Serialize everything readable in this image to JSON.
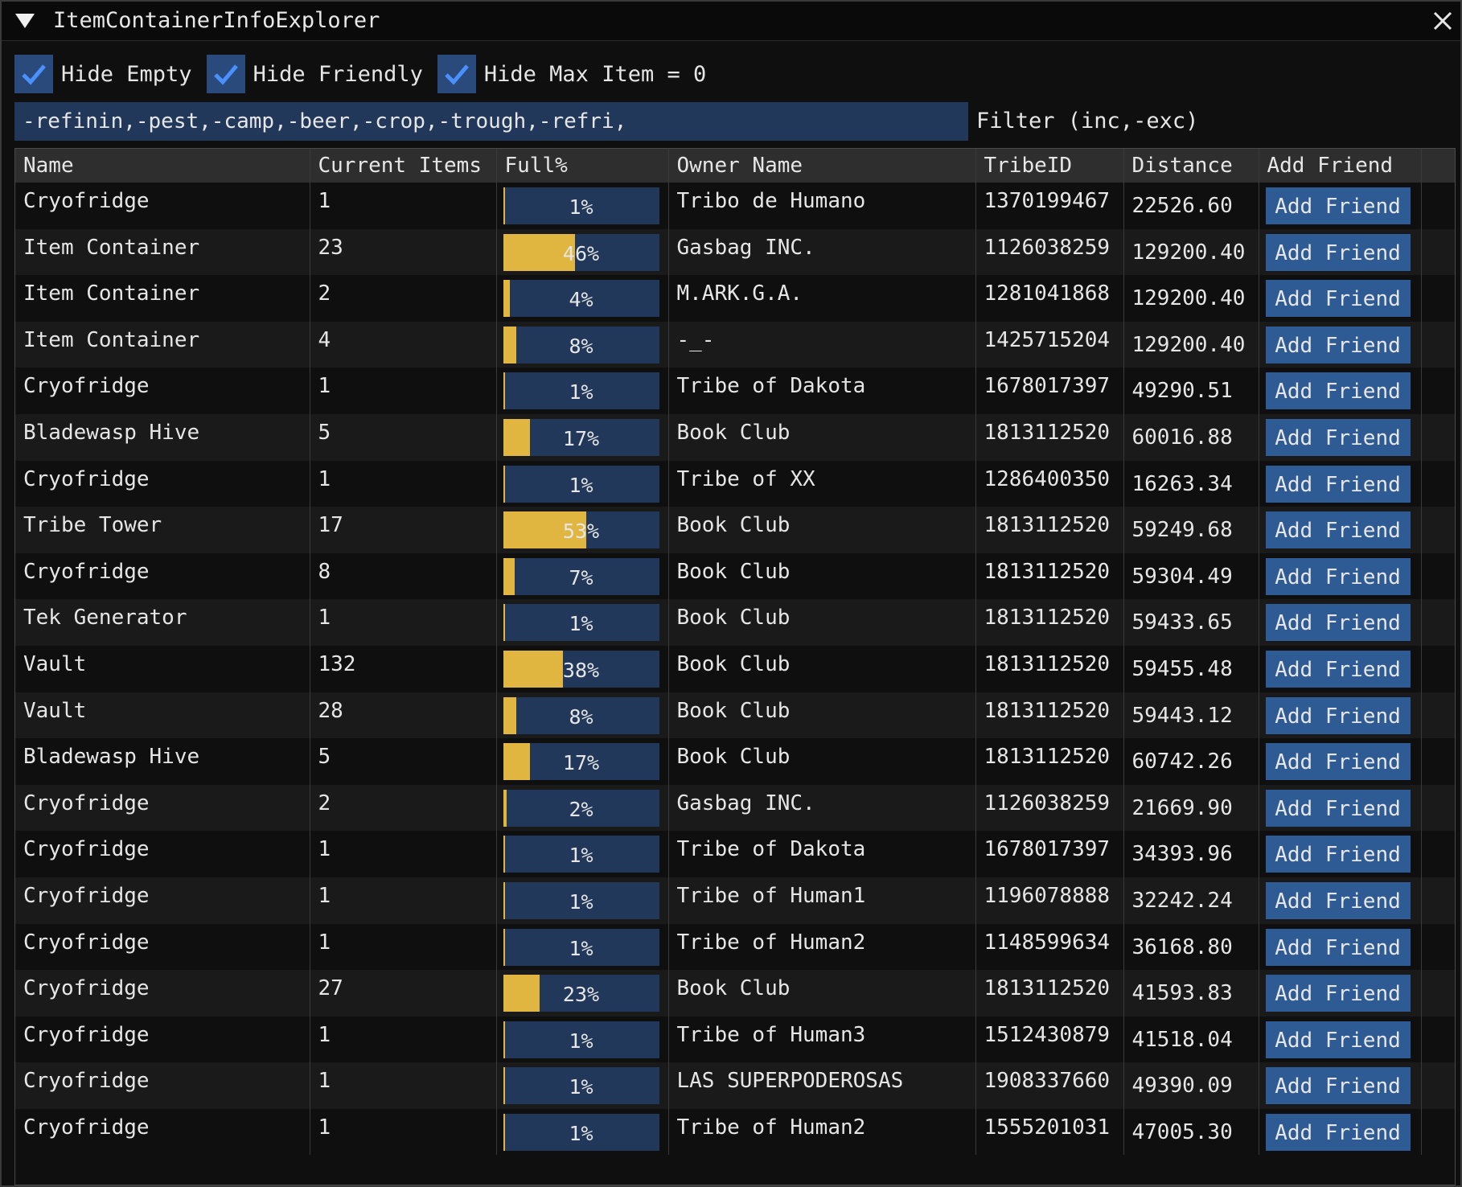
{
  "window": {
    "title": "ItemContainerInfoExplorer"
  },
  "toolbar": {
    "hide_empty": {
      "label": "Hide Empty",
      "checked": true
    },
    "hide_friendly": {
      "label": "Hide Friendly",
      "checked": true
    },
    "hide_max_item": {
      "label": "Hide Max Item = 0",
      "checked": true
    }
  },
  "filter": {
    "value": "-refinin,-pest,-camp,-beer,-crop,-trough,-refri,",
    "label": "Filter (inc,-exc)"
  },
  "table": {
    "columns": [
      "Name",
      "Current Items",
      "Full%",
      "Owner Name",
      "TribeID",
      "Distance",
      "Add Friend"
    ],
    "button_label": "Add Friend",
    "rows": [
      {
        "name": "Cryofridge",
        "current": "1",
        "full": 1,
        "full_text": "1%",
        "owner": "Tribo de Humano",
        "tribe_id": "1370199467",
        "distance": "22526.60"
      },
      {
        "name": "Item Container",
        "current": "23",
        "full": 46,
        "full_text": "46%",
        "owner": "Gasbag INC.",
        "tribe_id": "1126038259",
        "distance": "129200.40"
      },
      {
        "name": "Item Container",
        "current": "2",
        "full": 4,
        "full_text": "4%",
        "owner": "M.ARK.G.A.",
        "tribe_id": "1281041868",
        "distance": "129200.40"
      },
      {
        "name": "Item Container",
        "current": "4",
        "full": 8,
        "full_text": "8%",
        "owner": "-_-",
        "tribe_id": "1425715204",
        "distance": "129200.40"
      },
      {
        "name": "Cryofridge",
        "current": "1",
        "full": 1,
        "full_text": "1%",
        "owner": "Tribe of Dakota",
        "tribe_id": "1678017397",
        "distance": "49290.51"
      },
      {
        "name": "Bladewasp Hive",
        "current": "5",
        "full": 17,
        "full_text": "17%",
        "owner": "Book Club",
        "tribe_id": "1813112520",
        "distance": "60016.88"
      },
      {
        "name": "Cryofridge",
        "current": "1",
        "full": 1,
        "full_text": "1%",
        "owner": "Tribe of XX",
        "tribe_id": "1286400350",
        "distance": "16263.34"
      },
      {
        "name": "Tribe Tower",
        "current": "17",
        "full": 53,
        "full_text": "53%",
        "owner": "Book Club",
        "tribe_id": "1813112520",
        "distance": "59249.68"
      },
      {
        "name": "Cryofridge",
        "current": "8",
        "full": 7,
        "full_text": "7%",
        "owner": "Book Club",
        "tribe_id": "1813112520",
        "distance": "59304.49"
      },
      {
        "name": "Tek Generator",
        "current": "1",
        "full": 1,
        "full_text": "1%",
        "owner": "Book Club",
        "tribe_id": "1813112520",
        "distance": "59433.65"
      },
      {
        "name": "Vault",
        "current": "132",
        "full": 38,
        "full_text": "38%",
        "owner": "Book Club",
        "tribe_id": "1813112520",
        "distance": "59455.48"
      },
      {
        "name": "Vault",
        "current": "28",
        "full": 8,
        "full_text": "8%",
        "owner": "Book Club",
        "tribe_id": "1813112520",
        "distance": "59443.12"
      },
      {
        "name": "Bladewasp Hive",
        "current": "5",
        "full": 17,
        "full_text": "17%",
        "owner": "Book Club",
        "tribe_id": "1813112520",
        "distance": "60742.26"
      },
      {
        "name": "Cryofridge",
        "current": "2",
        "full": 2,
        "full_text": "2%",
        "owner": "Gasbag INC.",
        "tribe_id": "1126038259",
        "distance": "21669.90"
      },
      {
        "name": "Cryofridge",
        "current": "1",
        "full": 1,
        "full_text": "1%",
        "owner": "Tribe of Dakota",
        "tribe_id": "1678017397",
        "distance": "34393.96"
      },
      {
        "name": "Cryofridge",
        "current": "1",
        "full": 1,
        "full_text": "1%",
        "owner": "Tribe of Human1",
        "tribe_id": "1196078888",
        "distance": "32242.24"
      },
      {
        "name": "Cryofridge",
        "current": "1",
        "full": 1,
        "full_text": "1%",
        "owner": "Tribe of Human2",
        "tribe_id": "1148599634",
        "distance": "36168.80"
      },
      {
        "name": "Cryofridge",
        "current": "27",
        "full": 23,
        "full_text": "23%",
        "owner": "Book Club",
        "tribe_id": "1813112520",
        "distance": "41593.83"
      },
      {
        "name": "Cryofridge",
        "current": "1",
        "full": 1,
        "full_text": "1%",
        "owner": "Tribe of Human3",
        "tribe_id": "1512430879",
        "distance": "41518.04"
      },
      {
        "name": "Cryofridge",
        "current": "1",
        "full": 1,
        "full_text": "1%",
        "owner": "LAS SUPERPODEROSAS",
        "tribe_id": "1908337660",
        "distance": "49390.09"
      },
      {
        "name": "Cryofridge",
        "current": "1",
        "full": 1,
        "full_text": "1%",
        "owner": "Tribe of Human2",
        "tribe_id": "1555201031",
        "distance": "47005.30"
      }
    ]
  },
  "colors": {
    "accent": "#294a7a",
    "check": "#4a90ff",
    "bar_fill": "#e0b640",
    "bar_bg": "#22385a",
    "button": "#2f5b94"
  }
}
